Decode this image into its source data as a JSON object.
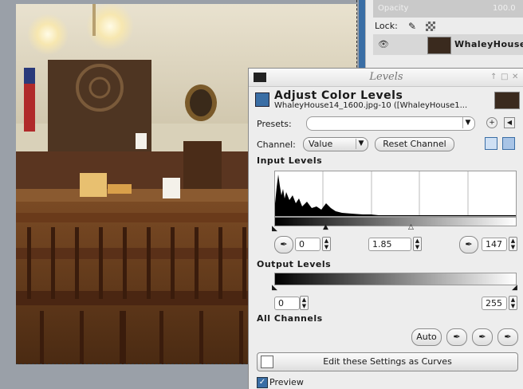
{
  "layers": {
    "mode_label": "Opacity",
    "opacity_value": "100.0",
    "lock_label": "Lock:",
    "layer_name": "WhaleyHouse"
  },
  "dialog": {
    "window_title": "Levels",
    "heading": "Adjust Color Levels",
    "subheading": "WhaleyHouse14_1600.jpg-10 ([WhaleyHouse1...",
    "presets_label": "Presets:",
    "presets_value": "",
    "channel_label": "Channel:",
    "channel_value": "Value",
    "reset_channel_label": "Reset Channel",
    "input_levels_label": "Input Levels",
    "input_low": "0",
    "input_gamma": "1.85",
    "input_high": "147",
    "output_levels_label": "Output Levels",
    "output_low": "0",
    "output_high": "255",
    "all_channels_label": "All Channels",
    "auto_label": "Auto",
    "edit_curves_label": "Edit these Settings as Curves",
    "preview_label": "Preview",
    "preview_checked": true
  },
  "colors": {
    "accent": "#3a6ea5",
    "dialog_bg": "#ededed",
    "histogram": "#000000"
  }
}
